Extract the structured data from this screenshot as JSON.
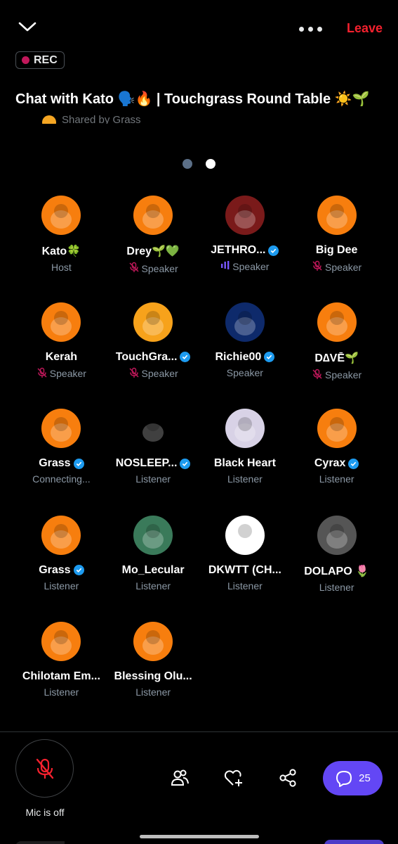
{
  "header": {
    "leave_label": "Leave",
    "rec_label": "REC"
  },
  "space": {
    "title": "Chat with Kato 🗣️🔥 | Touchgrass Round Table ☀️🌱",
    "shared_by": "Shared by Grass"
  },
  "pager": {
    "pages": 2,
    "current": 2
  },
  "participants": [
    {
      "name": "Kato🍀",
      "role": "Host",
      "verified": false,
      "muted": false,
      "speaking": false,
      "avatar": "frog-hat-avatar",
      "bg": "#f77e0e"
    },
    {
      "name": "Drey🌱💚",
      "role": "Speaker",
      "verified": false,
      "muted": true,
      "speaking": false,
      "avatar": "green-monster-avatar",
      "bg": "#f77e0e"
    },
    {
      "name": "JETHRO...",
      "role": "Speaker",
      "verified": true,
      "muted": false,
      "speaking": true,
      "avatar": "robot-armor-avatar",
      "bg": "#7a1a1a"
    },
    {
      "name": "Big Dee",
      "role": "Speaker",
      "verified": false,
      "muted": true,
      "speaking": false,
      "avatar": "frog-beanie-avatar",
      "bg": "#f77e0e"
    },
    {
      "name": "Kerah",
      "role": "Speaker",
      "verified": false,
      "muted": true,
      "speaking": false,
      "avatar": "pepe-frog-avatar",
      "bg": "#f77e0e"
    },
    {
      "name": "TouchGra...",
      "role": "Speaker",
      "verified": true,
      "muted": true,
      "speaking": false,
      "avatar": "sunrise-logo-avatar",
      "bg": "#f7a21b"
    },
    {
      "name": "Richie00",
      "role": "Speaker",
      "verified": true,
      "muted": false,
      "speaking": false,
      "avatar": "cartoon-boy-avatar",
      "bg": "#0e2a6b"
    },
    {
      "name": "D∆VĒ🌱",
      "role": "Speaker",
      "verified": false,
      "muted": true,
      "speaking": false,
      "avatar": "frog-shades-avatar",
      "bg": "#f77e0e"
    },
    {
      "name": "Grass",
      "role": "Connecting...",
      "verified": true,
      "muted": false,
      "speaking": false,
      "avatar": "grass-frog-avatar",
      "bg": "#f77e0e"
    },
    {
      "name": "NOSLEEP...",
      "role": "Listener",
      "verified": true,
      "muted": false,
      "speaking": false,
      "avatar": "crowned-creature-avatar",
      "bg": "#000000"
    },
    {
      "name": "Black Heart",
      "role": "Listener",
      "verified": false,
      "muted": false,
      "speaking": false,
      "avatar": "teddy-bear-avatar",
      "bg": "#d8d2e6"
    },
    {
      "name": "Cyrax",
      "role": "Listener",
      "verified": true,
      "muted": false,
      "speaking": false,
      "avatar": "frog-headphones-avatar",
      "bg": "#f77e0e"
    },
    {
      "name": "Grass",
      "role": "Listener",
      "verified": true,
      "muted": false,
      "speaking": false,
      "avatar": "grass-frog-avatar",
      "bg": "#f77e0e"
    },
    {
      "name": "Mo_Lecular",
      "role": "Listener",
      "verified": false,
      "muted": false,
      "speaking": false,
      "avatar": "colorful-portrait-avatar",
      "bg": "#3a7a5a"
    },
    {
      "name": "DKWTT (CH...",
      "role": "Listener",
      "verified": false,
      "muted": false,
      "speaking": false,
      "avatar": "masked-figure-avatar",
      "bg": "#ffffff"
    },
    {
      "name": "DOLAPO 🌷",
      "role": "Listener",
      "verified": false,
      "muted": false,
      "speaking": false,
      "avatar": "bw-portrait-avatar",
      "bg": "#555555"
    },
    {
      "name": "Chilotam Em...",
      "role": "Listener",
      "verified": false,
      "muted": false,
      "speaking": false,
      "avatar": "pepe-frog-avatar",
      "bg": "#f77e0e"
    },
    {
      "name": "Blessing Olu...",
      "role": "Listener",
      "verified": false,
      "muted": false,
      "speaking": false,
      "avatar": "pepe-frog-avatar",
      "bg": "#f77e0e"
    }
  ],
  "bottom": {
    "mic_label": "Mic is off",
    "chat_count": "25"
  },
  "colors": {
    "accent": "#1d9bf0",
    "leave": "#f4212e",
    "muted_icon": "#c2185b",
    "chat_pill": "#6347f5"
  }
}
